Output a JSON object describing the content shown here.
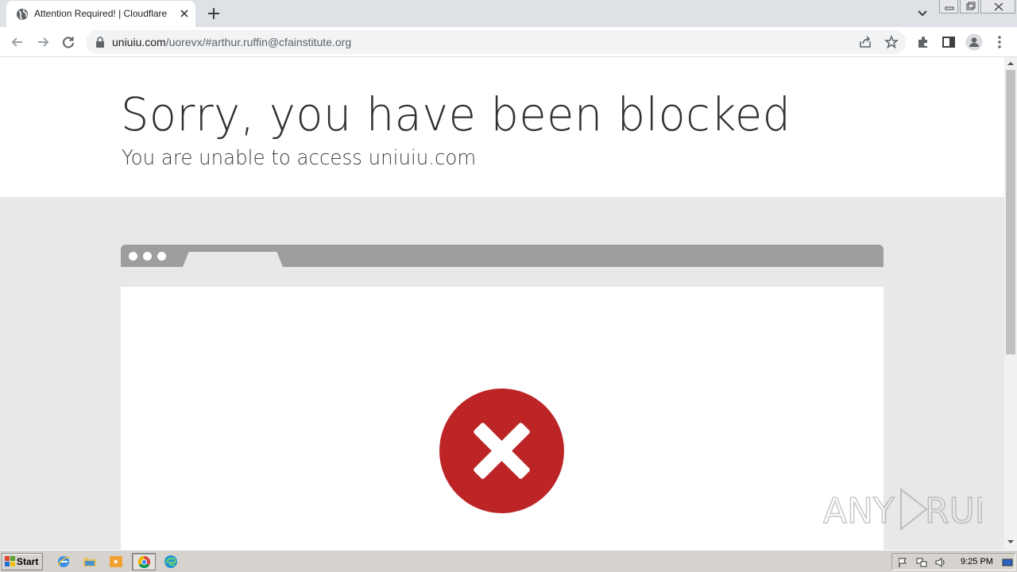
{
  "browser": {
    "tab_title": "Attention Required! | Cloudflare",
    "url_host": "uniuiu.com",
    "url_path": "/uorevx/#arthur.ruffin@cfainstitute.org"
  },
  "page": {
    "headline": "Sorry, you have been blocked",
    "subline": "You are unable to access uniuiu.com"
  },
  "watermark": {
    "left": "ANY",
    "right": "RUN"
  },
  "taskbar": {
    "start_label": "Start",
    "clock": "9:25 PM"
  },
  "icons": [
    "globe-icon",
    "close-icon",
    "plus-icon",
    "chevron-down-icon",
    "back-arrow-icon",
    "forward-arrow-icon",
    "reload-icon",
    "lock-icon",
    "share-icon",
    "star-icon",
    "extensions-icon",
    "side-panel-icon",
    "profile-icon",
    "more-vert-icon",
    "error-x-icon"
  ],
  "colors": {
    "error_red": "#bd2426",
    "frame_gray": "#9e9e9e",
    "page_bg": "#e8e8e8"
  }
}
